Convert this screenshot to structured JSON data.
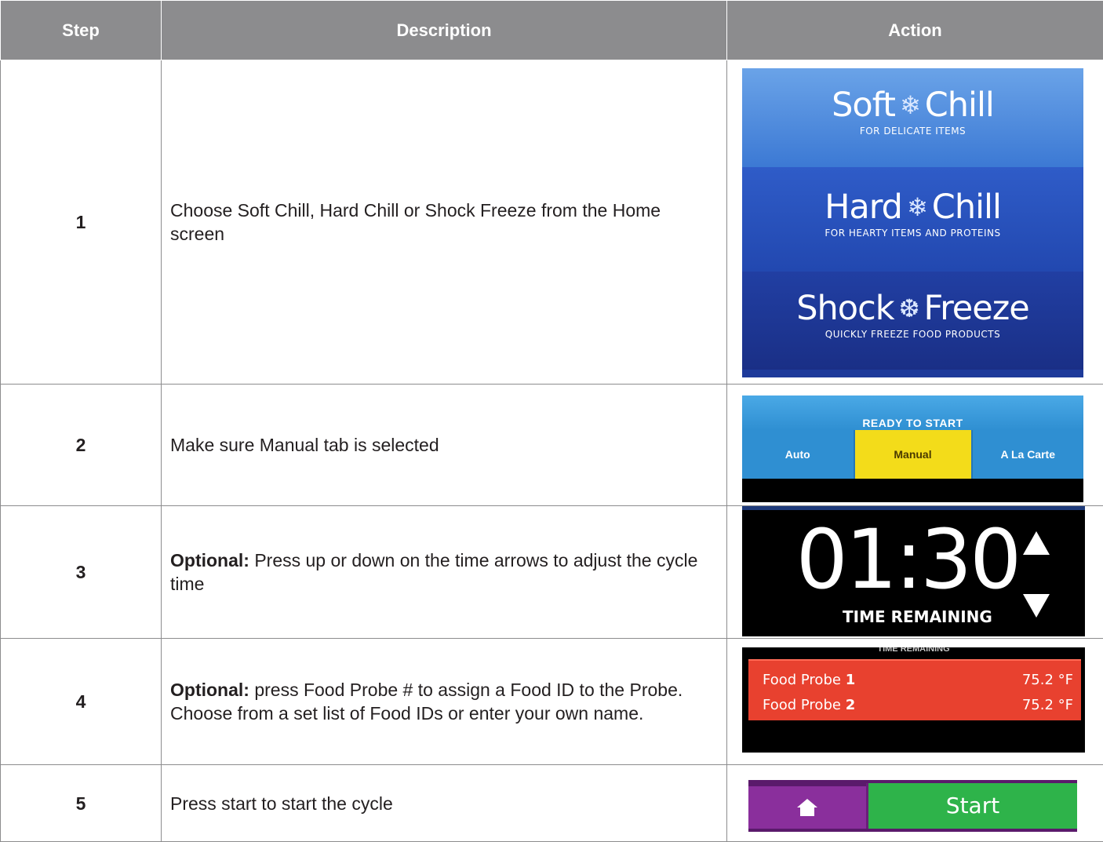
{
  "headers": {
    "step": "Step",
    "description": "Description",
    "action": "Action"
  },
  "rows": [
    {
      "step": "1",
      "bold": "",
      "text": "Choose Soft Chill, Hard Chill or Shock Freeze from the Home screen"
    },
    {
      "step": "2",
      "bold": "",
      "text": "Make sure Manual tab is selected"
    },
    {
      "step": "3",
      "bold": "Optional:",
      "text": " Press up or down on the time arrows to adjust the cycle time"
    },
    {
      "step": "4",
      "bold": "Optional:",
      "text": " press Food Probe # to assign a Food ID to the Probe. Choose from a set list of Food IDs or enter your own name."
    },
    {
      "step": "5",
      "bold": "",
      "text": "Press start to start the cycle"
    }
  ],
  "home_screen": {
    "soft": {
      "left": "Soft",
      "right": "Chill",
      "sub": "FOR DELICATE ITEMS"
    },
    "hard": {
      "left": "Hard",
      "right": "Chill",
      "sub": "FOR HEARTY ITEMS AND PROTEINS"
    },
    "shock": {
      "left": "Shock",
      "right": "Freeze",
      "sub": "QUICKLY FREEZE FOOD PRODUCTS"
    }
  },
  "mode_tabs": {
    "status": "READY TO START",
    "tabs": [
      "Auto",
      "Manual",
      "A La Carte"
    ],
    "selected": "Manual"
  },
  "timer": {
    "value": "01:30",
    "label": "TIME REMAINING"
  },
  "probes": {
    "cut_label": "TIME REMAINING",
    "items": [
      {
        "name": "Food Probe",
        "num": "1",
        "temp": "75.2 °F"
      },
      {
        "name": "Food Probe",
        "num": "2",
        "temp": "75.2 °F"
      }
    ]
  },
  "start": {
    "label": "Start"
  },
  "colors": {
    "header_bg": "#8c8c8e",
    "manual_tab": "#f3dc1a",
    "probe_bg": "#e8412f",
    "start_bg": "#2eb34a",
    "home_bg": "#8a2f9c"
  }
}
